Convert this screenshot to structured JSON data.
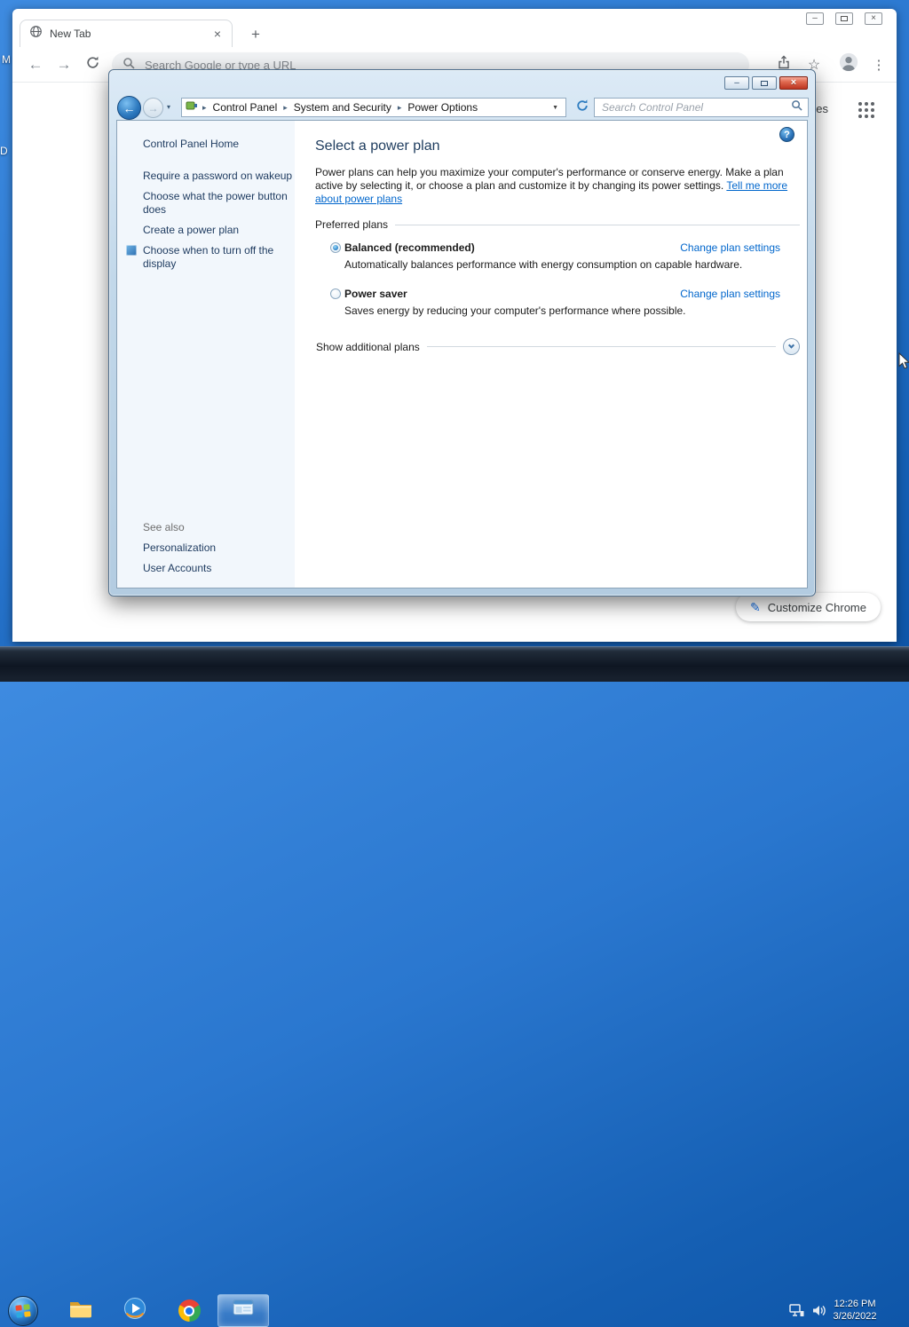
{
  "theme": {
    "desktop_blue": "#2a77cf",
    "link_blue": "#0066cc",
    "heading_navy": "#1e3c5e",
    "close_button_red": "#d5523e",
    "chrome_accent": "#1a73e8"
  },
  "icons": {
    "breadcrumb_separator": "▸",
    "address_dropdown": "▼",
    "recent_chevron": "▾",
    "back_arrow": "←",
    "forward_arrow": "→",
    "plus": "+",
    "close": "×",
    "minimize": "–",
    "help": "?",
    "menu_dots": "⋮",
    "star": "☆",
    "pencil": "✎"
  },
  "desktop": {
    "fragments": {
      "top": "M",
      "bottom": "D"
    }
  },
  "browser": {
    "tab": {
      "title": "New Tab"
    },
    "omnibox": {
      "placeholder": "Search Google or type a URL"
    },
    "newtab": {
      "images_partial": "ges",
      "customize": "Customize Chrome"
    }
  },
  "control_panel": {
    "breadcrumb": {
      "items": [
        "Control Panel",
        "System and Security",
        "Power Options"
      ]
    },
    "search": {
      "placeholder": "Search Control Panel"
    },
    "sidebar": {
      "home": "Control Panel Home",
      "tasks": [
        "Require a password on wakeup",
        "Choose what the power button does",
        "Create a power plan",
        "Choose when to turn off the display"
      ],
      "see_also": "See also",
      "links": [
        "Personalization",
        "User Accounts"
      ]
    },
    "main": {
      "heading": "Select a power plan",
      "intro": "Power plans can help you maximize your computer's performance or conserve energy. Make a plan active by selecting it, or choose a plan and customize it by changing its power settings.",
      "intro_link": "Tell me more about power plans",
      "group": "Preferred plans",
      "plans": [
        {
          "name": "Balanced (recommended)",
          "selected": true,
          "description": "Automatically balances performance with energy consumption on capable hardware.",
          "action": "Change plan settings"
        },
        {
          "name": "Power saver",
          "selected": false,
          "description": "Saves energy by reducing your computer's performance where possible.",
          "action": "Change plan settings"
        }
      ],
      "show_additional": "Show additional plans"
    }
  },
  "taskbar": {
    "clock": {
      "time": "12:26 PM",
      "date": "3/26/2022"
    }
  }
}
